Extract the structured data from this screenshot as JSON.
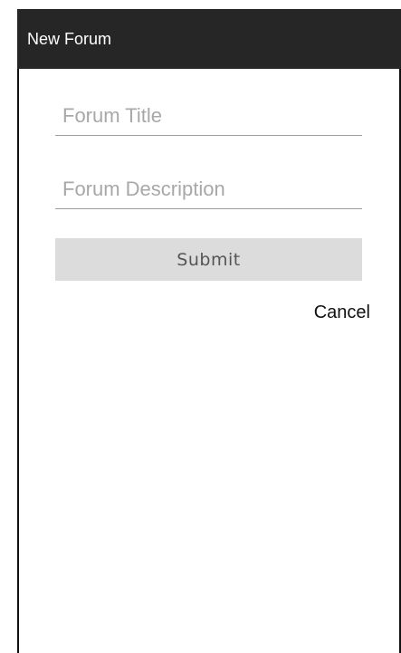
{
  "app_bar": {
    "title": "New Forum"
  },
  "form": {
    "title_field": {
      "value": "",
      "placeholder": "Forum Title"
    },
    "description_field": {
      "value": "",
      "placeholder": "Forum Description"
    },
    "submit_label": "Submit",
    "cancel_label": "Cancel"
  },
  "colors": {
    "app_bar_background": "#262626",
    "app_bar_text": "#ffffff",
    "button_background": "#dcdcdc",
    "placeholder_text": "#a8a8a8",
    "field_underline": "#9e9e9e"
  }
}
